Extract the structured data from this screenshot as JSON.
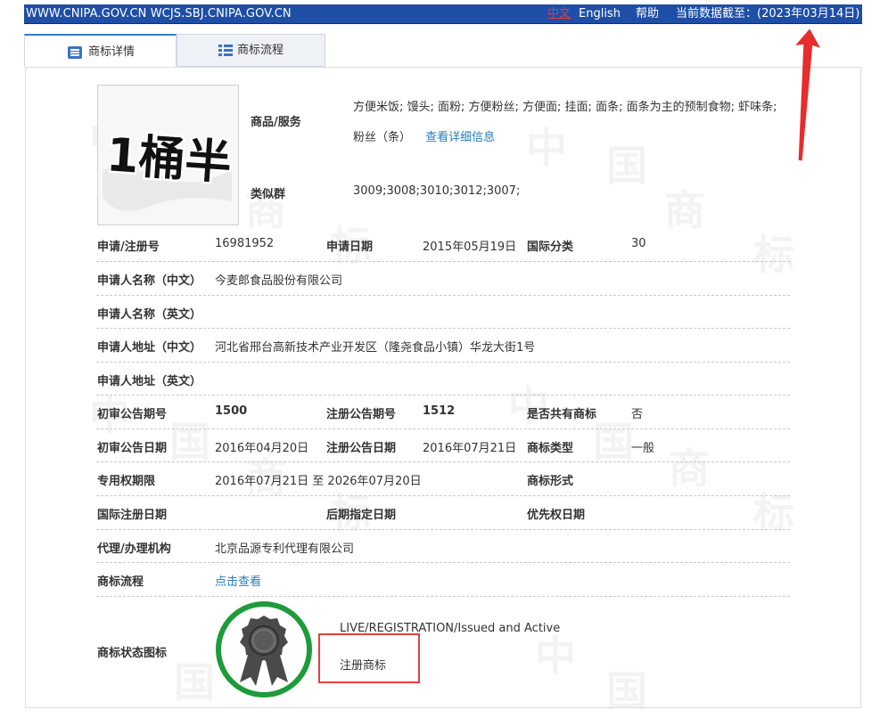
{
  "topbar": {
    "site": "WWW.CNIPA.GOV.CN WCJS.SBJ.CNIPA.GOV.CN",
    "lang_cn": "中文",
    "lang_en": "English",
    "help": "帮助",
    "data_date": "当前数据截至：(2023年03月14日)"
  },
  "tabs": [
    {
      "label": "商标详情",
      "icon": "list-icon"
    },
    {
      "label": "商标流程",
      "icon": "grid-list-icon"
    }
  ],
  "trademark": {
    "image_text": "1桶半",
    "goods_label": "商品/服务",
    "goods_value": "方便米饭; 馒头; 面粉; 方便粉丝; 方便面; 挂面; 面条; 面条为主的预制食物; 虾味条; 粉丝（条）",
    "goods_link": "查看详细信息",
    "similar_label": "类似群",
    "similar_value": "3009;3008;3010;3012;3007;"
  },
  "rows": {
    "reg_no_label": "申请/注册号",
    "reg_no": "16981952",
    "app_date_label": "申请日期",
    "app_date": "2015年05月19日",
    "intl_class_label": "国际分类",
    "intl_class": "30",
    "applicant_cn_label": "申请人名称（中文）",
    "applicant_cn": "今麦郎食品股份有限公司",
    "applicant_en_label": "申请人名称（英文）",
    "applicant_en": "",
    "address_cn_label": "申请人地址（中文）",
    "address_cn": "河北省邢台高新技术产业开发区（隆尧食品小镇）华龙大街1号",
    "address_en_label": "申请人地址（英文）",
    "address_en": "",
    "prelim_issue_label": "初审公告期号",
    "prelim_issue": "1500",
    "reg_issue_label": "注册公告期号",
    "reg_issue": "1512",
    "shared_label": "是否共有商标",
    "shared": "否",
    "prelim_date_label": "初审公告日期",
    "prelim_date": "2016年04月20日",
    "reg_date_label": "注册公告日期",
    "reg_date": "2016年07月21日",
    "tm_type_label": "商标类型",
    "tm_type": "一般",
    "term_label": "专用权期限",
    "term": "2016年07月21日 至 2026年07月20日",
    "tm_form_label": "商标形式",
    "tm_form": "",
    "intl_reg_date_label": "国际注册日期",
    "intl_reg_date": "",
    "later_date_label": "后期指定日期",
    "later_date": "",
    "priority_date_label": "优先权日期",
    "priority_date": "",
    "agent_label": "代理/办理机构",
    "agent": "北京品源专利代理有限公司",
    "flow_label": "商标流程",
    "flow_link": "点击查看",
    "status_label": "商标状态图标"
  },
  "status": {
    "en": "LIVE/REGISTRATION/Issued and Active",
    "cn": "注册商标",
    "seal_ring_color": "#1e9b3a",
    "seal_color": "#4a4a4a"
  },
  "watermark": [
    "中",
    "国",
    "商",
    "标"
  ],
  "accent": {
    "topbar": "#1e4ea6",
    "link": "#2a7dbd",
    "highlight": "#e24040"
  }
}
